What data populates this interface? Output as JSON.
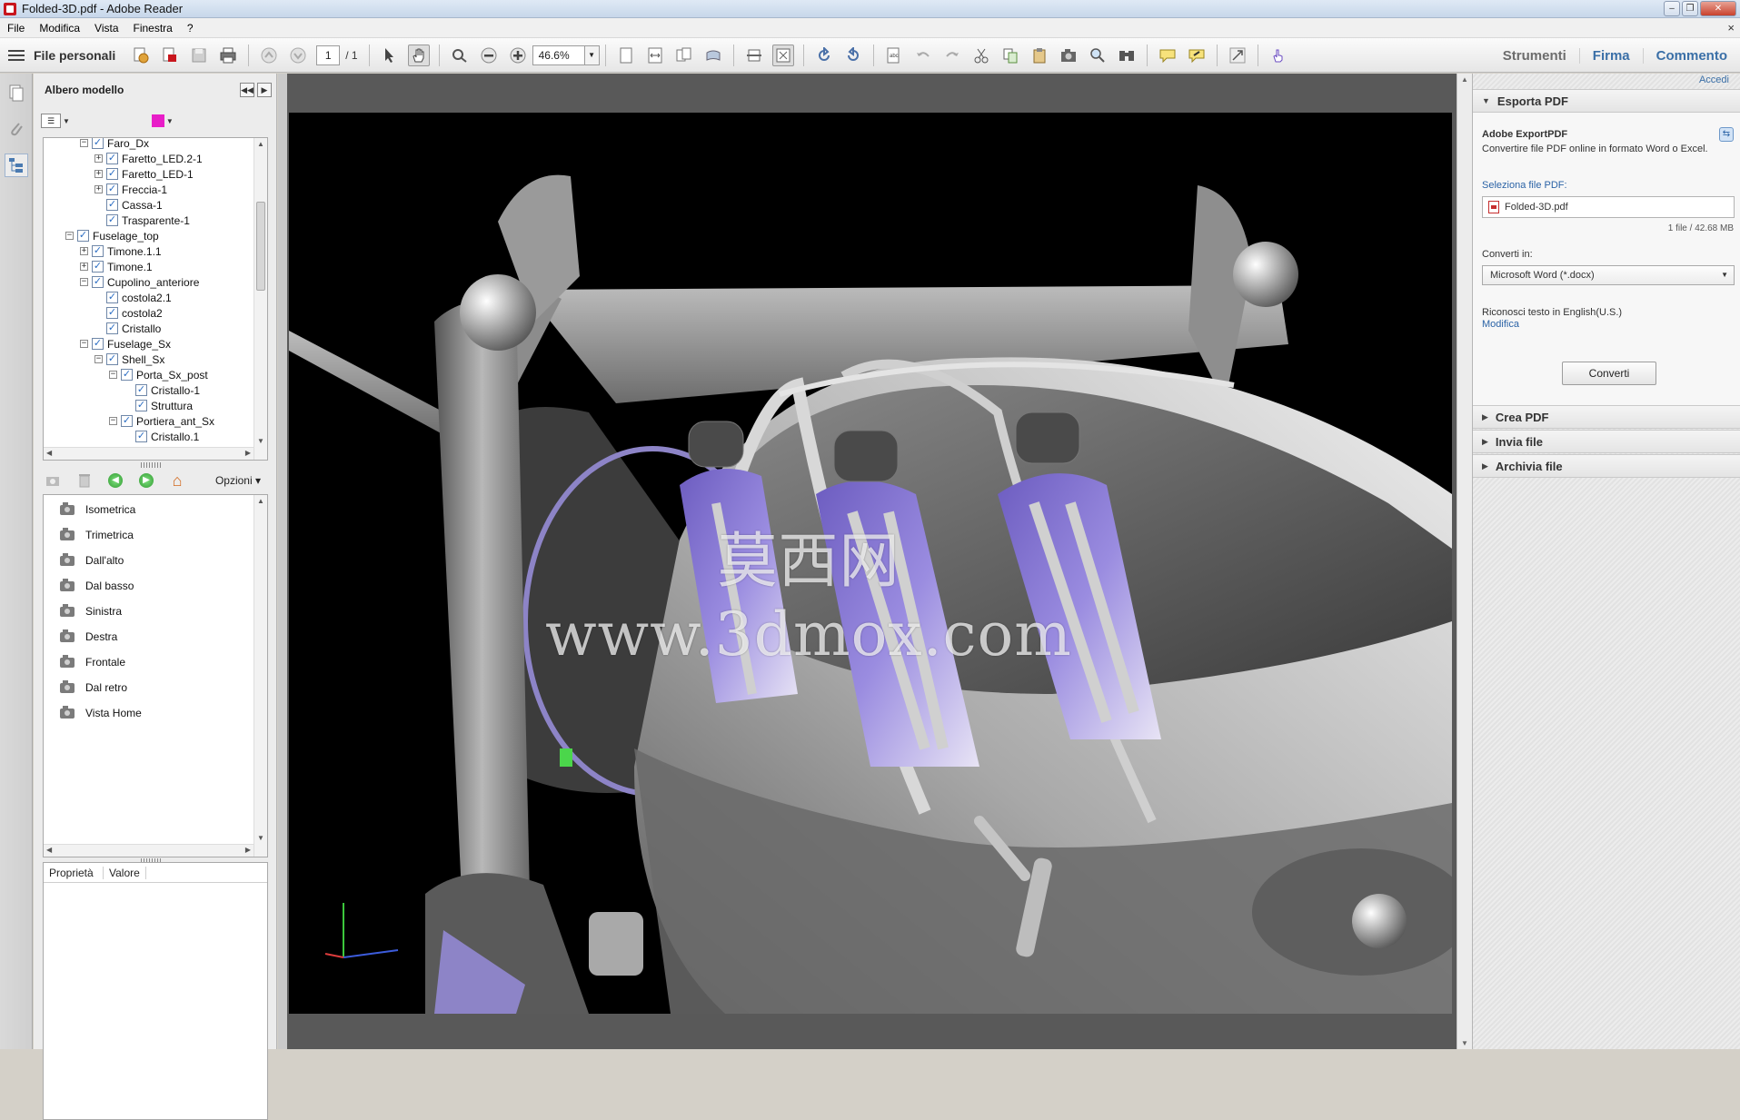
{
  "window": {
    "title": "Folded-3D.pdf - Adobe Reader",
    "controls": {
      "minimize": "–",
      "restore": "❐",
      "close": "✕"
    }
  },
  "menu": [
    "File",
    "Modifica",
    "Vista",
    "Finestra",
    "?"
  ],
  "menu_close": "×",
  "toolbar": {
    "file_personali": "File personali",
    "page_current": "1",
    "page_total": "/ 1",
    "zoom": "46.6%",
    "links": [
      "Strumenti",
      "Firma",
      "Commento"
    ]
  },
  "model_tree": {
    "title": "Albero modello",
    "nodes": [
      {
        "label": "Faro_Dx",
        "level": 3,
        "expander": "−"
      },
      {
        "label": "Faretto_LED.2-1",
        "level": 4,
        "expander": "+"
      },
      {
        "label": "Faretto_LED-1",
        "level": 4,
        "expander": "+"
      },
      {
        "label": "Freccia-1",
        "level": 4,
        "expander": "+"
      },
      {
        "label": "Cassa-1",
        "level": 4,
        "expander": ""
      },
      {
        "label": "Trasparente-1",
        "level": 4,
        "expander": ""
      },
      {
        "label": "Fuselage_top",
        "level": 2,
        "expander": "−"
      },
      {
        "label": "Timone.1.1",
        "level": 3,
        "expander": "+"
      },
      {
        "label": "Timone.1",
        "level": 3,
        "expander": "+"
      },
      {
        "label": "Cupolino_anteriore",
        "level": 3,
        "expander": "−"
      },
      {
        "label": "costola2.1",
        "level": 4,
        "expander": ""
      },
      {
        "label": "costola2",
        "level": 4,
        "expander": ""
      },
      {
        "label": "Cristallo",
        "level": 4,
        "expander": ""
      },
      {
        "label": "Fuselage_Sx",
        "level": 3,
        "expander": "−"
      },
      {
        "label": "Shell_Sx",
        "level": 4,
        "expander": "−"
      },
      {
        "label": "Porta_Sx_post",
        "level": 5,
        "expander": "−"
      },
      {
        "label": "Cristallo-1",
        "level": 6,
        "expander": ""
      },
      {
        "label": "Struttura",
        "level": 6,
        "expander": ""
      },
      {
        "label": "Portiera_ant_Sx",
        "level": 5,
        "expander": "−"
      },
      {
        "label": "Cristallo.1",
        "level": 6,
        "expander": ""
      }
    ],
    "check_mark": "✓",
    "highlight_color": "#e81ec8"
  },
  "views_tools": {
    "options": "Opzioni ▾",
    "home_icon": "⌂"
  },
  "views": [
    "Isometrica",
    "Trimetrica",
    "Dall'alto",
    "Dal basso",
    "Sinistra",
    "Destra",
    "Frontale",
    "Dal retro",
    "Vista Home"
  ],
  "properties": {
    "col1": "Proprietà",
    "col2": "Valore"
  },
  "document": {
    "watermark": "莫西网www.3dmox.com"
  },
  "right_panel": {
    "signin": "Accedi",
    "export": {
      "title": "Esporta PDF",
      "service": "Adobe ExportPDF",
      "desc": "Convertire file PDF online in formato Word o Excel.",
      "select_label": "Seleziona file PDF:",
      "file": "Folded-3D.pdf",
      "file_info": "1 file / 42.68 MB",
      "convert_label": "Converti in:",
      "format": "Microsoft Word (*.docx)",
      "ocr_text": "Riconosci testo in English(U.S.)",
      "modify": "Modifica",
      "convert_button": "Converti"
    },
    "sections": [
      "Crea PDF",
      "Invia file",
      "Archivia file"
    ]
  },
  "colors": {
    "accent_blue": "#3a6fa7",
    "seat_purple": "#7a6cc8",
    "viewport_bg": "#000000"
  }
}
